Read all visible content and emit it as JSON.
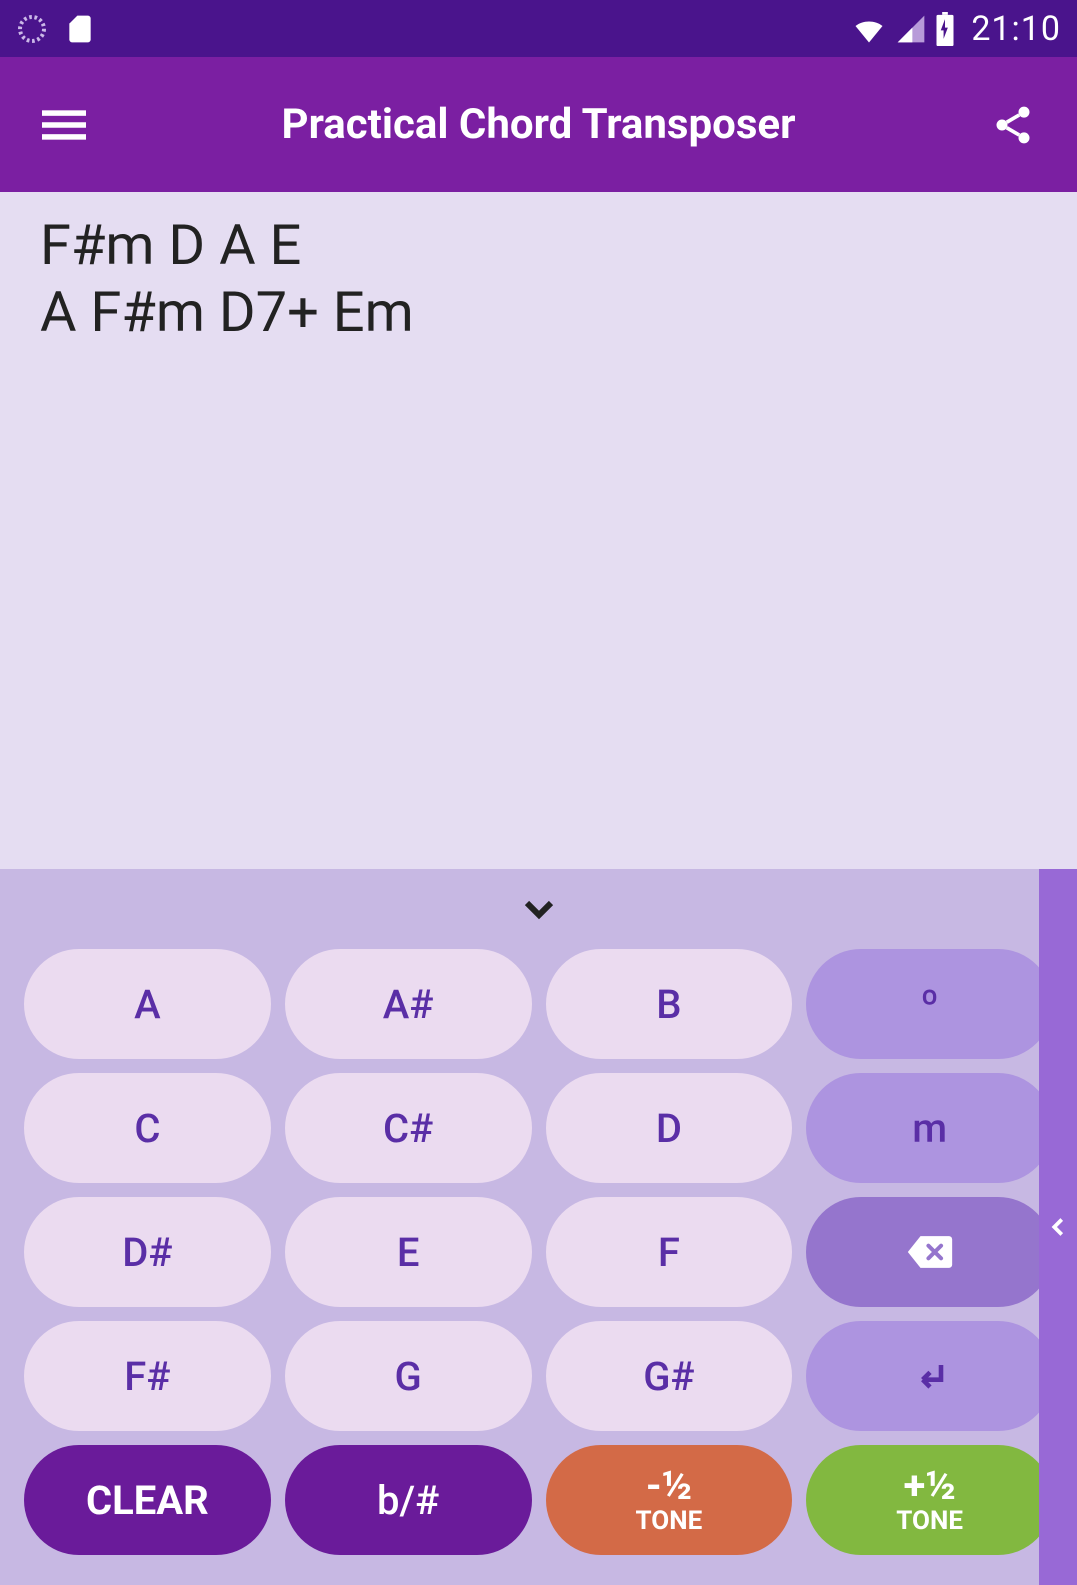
{
  "status": {
    "time": "21:10"
  },
  "header": {
    "title": "Practical Chord Transposer"
  },
  "chords": "F#m D A E\nA F#m D7+ Em",
  "keys": {
    "r1": [
      "A",
      "A#",
      "B"
    ],
    "r2": [
      "C",
      "C#",
      "D"
    ],
    "r3": [
      "D#",
      "E",
      "F"
    ],
    "r4": [
      "F#",
      "G",
      "G#"
    ],
    "mod_dim": "º",
    "mod_m": "m",
    "clear": "CLEAR",
    "bsharp": "b/#",
    "minus_frac": "-½",
    "plus_frac": "+½",
    "tone": "TONE"
  }
}
